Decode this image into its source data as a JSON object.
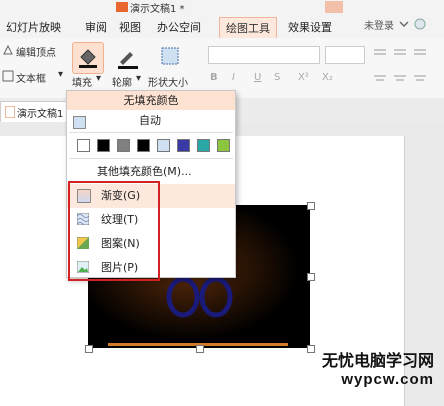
{
  "window": {
    "title": "演示文稿1 *"
  },
  "tabs": [
    "幻灯片放映",
    "审阅",
    "视图",
    "办公空间",
    "绘图工具",
    "效果设置"
  ],
  "login": "未登录",
  "ribbon": {
    "edit_vertex": "编辑顶点",
    "textbox": "文本框",
    "fill": "填充",
    "outline": "轮廓",
    "shape_size": "形状大小"
  },
  "doc_tab": "演示文稿1",
  "menu": {
    "no_fill": "无填充颜色",
    "auto": "自动",
    "swatches": [
      "#ffffff",
      "#000000",
      "#808080",
      "#000000",
      "#cfe0f3",
      "#3a3aa6",
      "#2aa7a7",
      "#8cc63e"
    ],
    "more": "其他填充颜色(M)...",
    "items": [
      {
        "label": "渐变(G)",
        "icon": "gradient-icon"
      },
      {
        "label": "纹理(T)",
        "icon": "texture-icon"
      },
      {
        "label": "图案(N)",
        "icon": "pattern-icon"
      },
      {
        "label": "图片(P)",
        "icon": "picture-icon"
      }
    ]
  },
  "watermark": {
    "line1": "无忧电脑学习网",
    "line2": "wypcw.com"
  }
}
